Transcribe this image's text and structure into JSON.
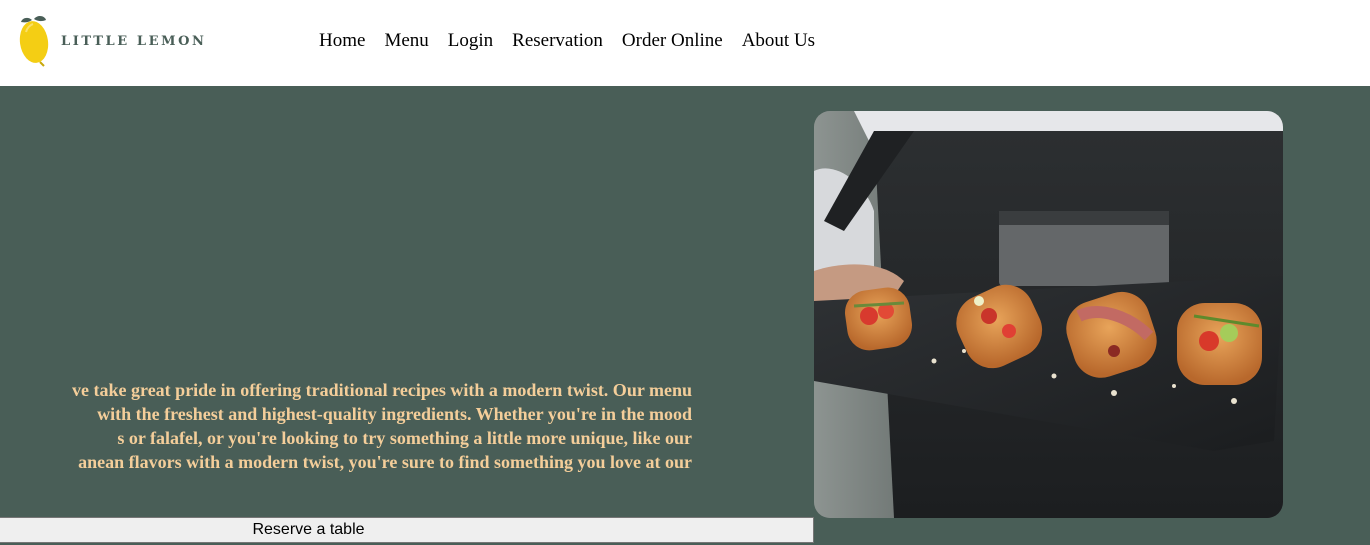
{
  "brand": {
    "logo_text": "LITTLE LEMON",
    "colors": {
      "primary_green": "#495e57",
      "accent_yellow": "#f4ce14",
      "hero_text": "#f4ce9a"
    }
  },
  "nav": {
    "items": [
      {
        "label": "Home"
      },
      {
        "label": "Menu"
      },
      {
        "label": "Login"
      },
      {
        "label": "Reservation"
      },
      {
        "label": "Order Online"
      },
      {
        "label": "About Us"
      }
    ]
  },
  "hero": {
    "lines": [
      "ve take great pride in offering traditional recipes with a modern twist. Our menu",
      " with the freshest and highest-quality ingredients. Whether you're in the mood",
      "s or falafel, or you're looking to try something a little more unique, like our",
      "anean flavors with a modern twist, you're sure to find something you love at our"
    ],
    "reserve_label": "Reserve a table",
    "image_icon": "bruschetta-tray-photo"
  }
}
